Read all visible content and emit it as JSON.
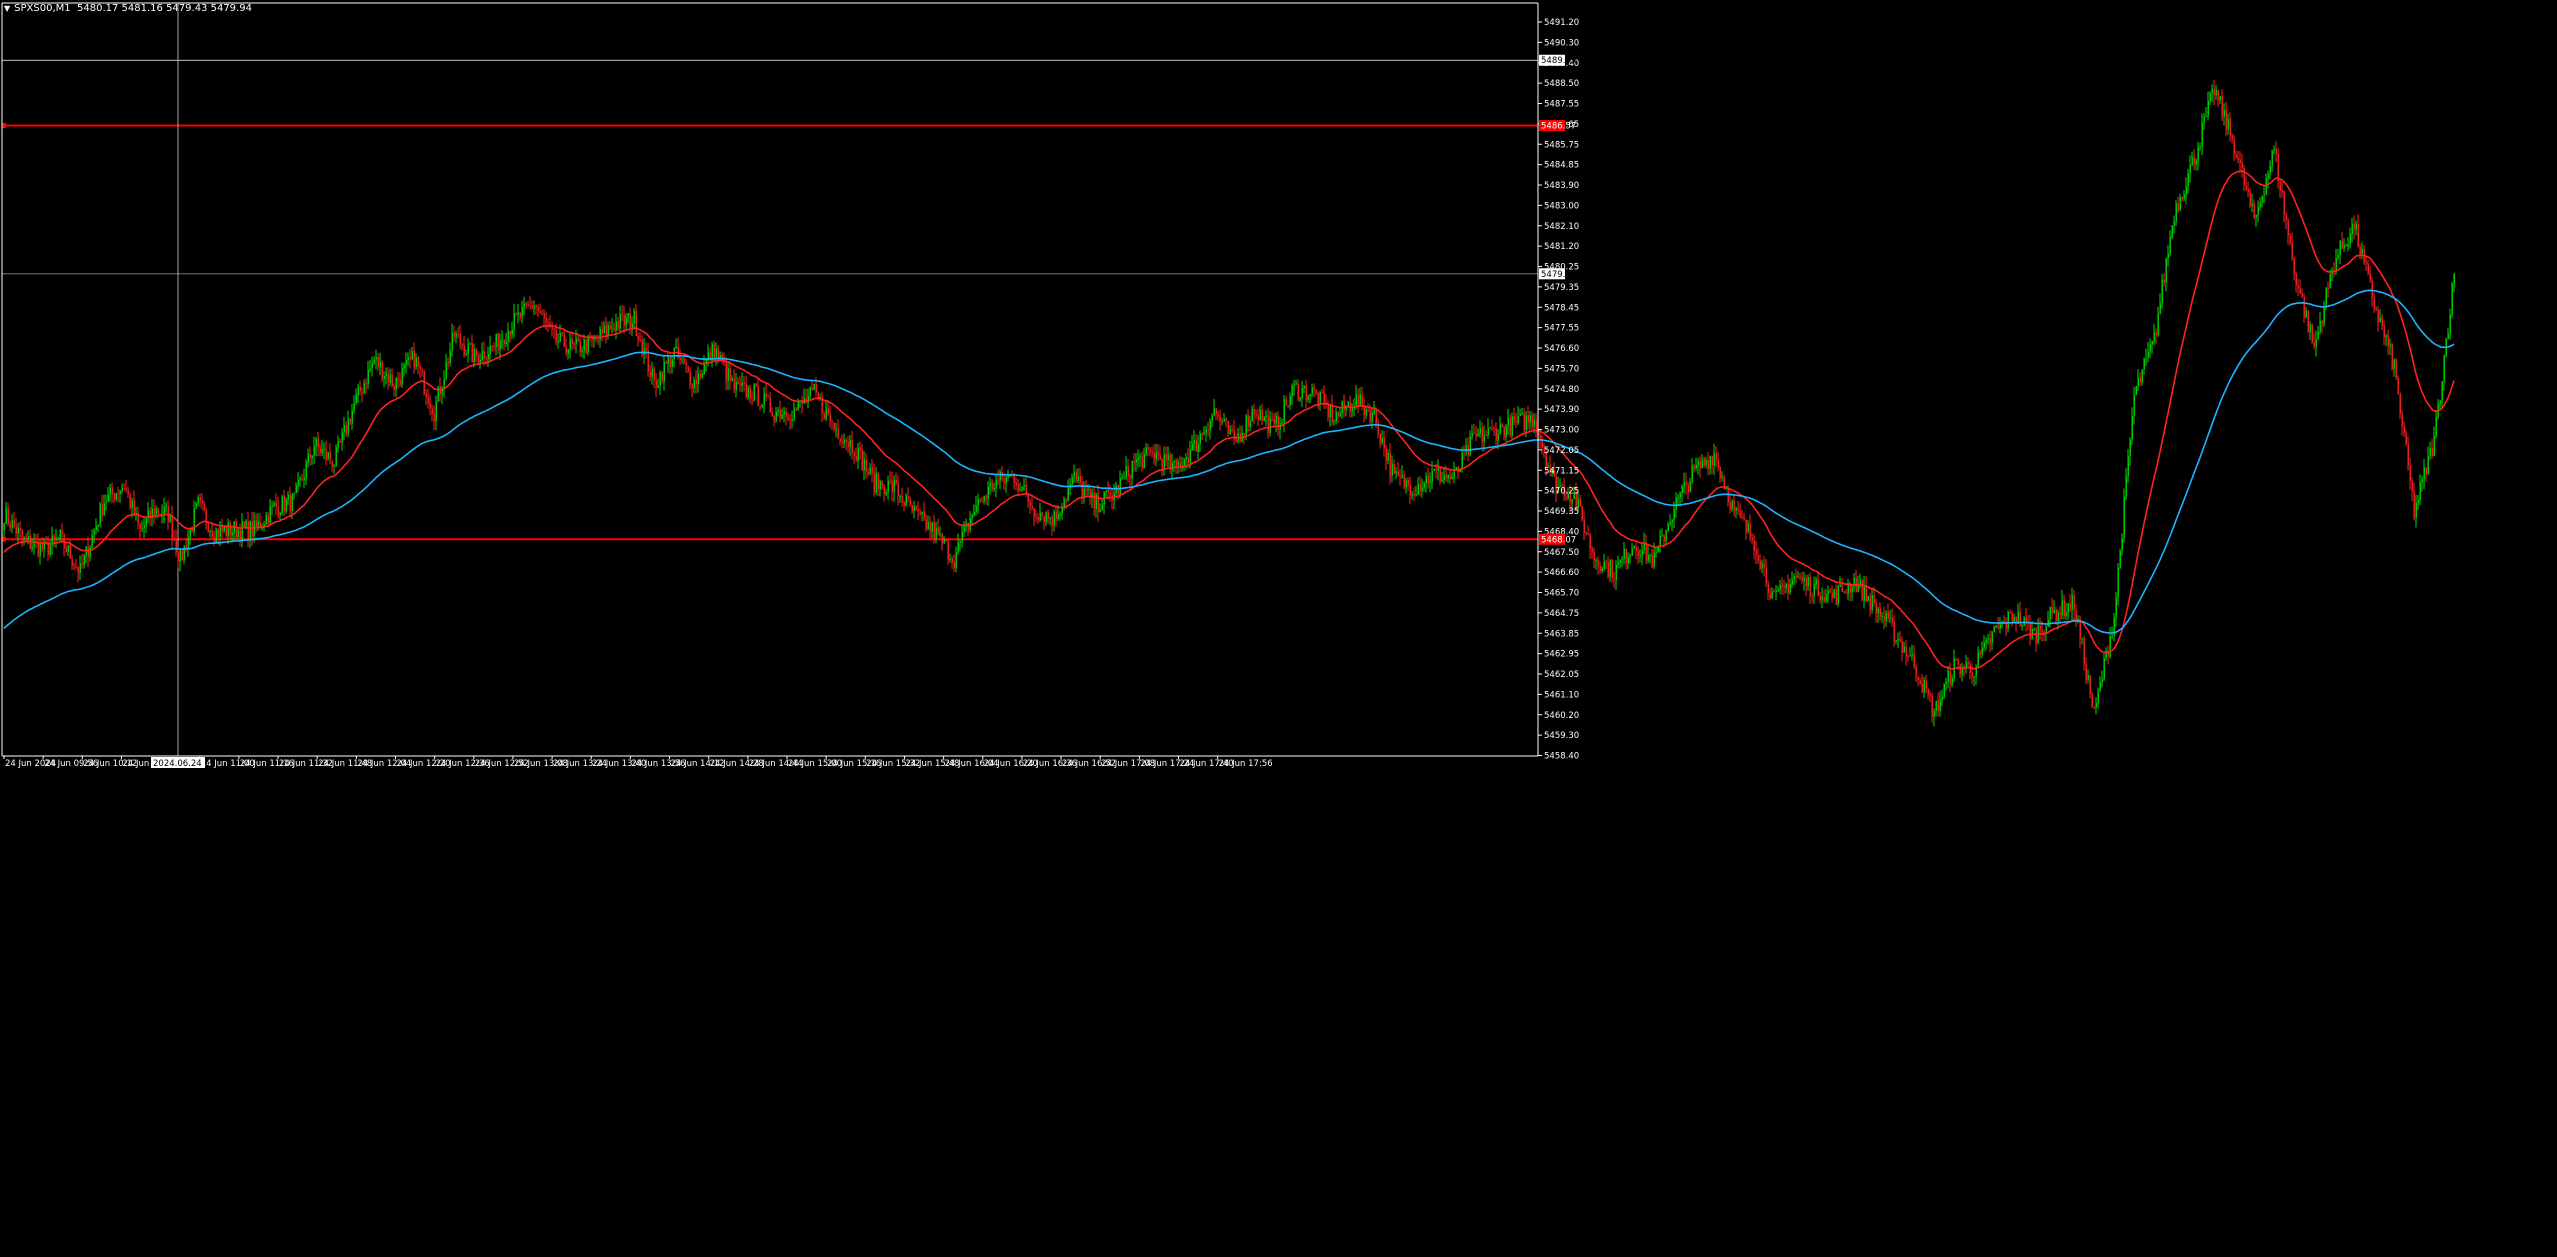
{
  "header": {
    "symbol": "SPXS00,M1",
    "ohlc": "5480.17 5481.16 5479.43 5479.94"
  },
  "colors": {
    "background": "#000000",
    "bull_candle": "#00dd00",
    "bear_candle": "#ff2222",
    "ma_fast": "#ff2222",
    "ma_slow": "#1eb4ff",
    "level_line": "#ff0000",
    "axis": "#ffffff",
    "grid_line": "#ffffff"
  },
  "chart_data": {
    "type": "candlestick",
    "timeframe": "M1",
    "y_ticks": [
      "5491.20",
      "5490.30",
      "5489.40",
      "5488.50",
      "5487.55",
      "5486.65",
      "5485.75",
      "5484.85",
      "5483.90",
      "5483.00",
      "5482.10",
      "5481.20",
      "5480.25",
      "5479.35",
      "5478.45",
      "5477.55",
      "5476.60",
      "5475.70",
      "5474.80",
      "5473.90",
      "5473.00",
      "5472.05",
      "5471.15",
      "5470.25",
      "5469.35",
      "5468.40",
      "5467.50",
      "5466.60",
      "5465.70",
      "5464.75",
      "5463.85",
      "5462.95",
      "5462.05",
      "5461.10",
      "5460.20",
      "5459.30",
      "5458.40"
    ],
    "ylim": [
      5458.0,
      5491.9
    ],
    "x_ticks": [
      "24 Jun 2024",
      "24 Jun 09:56",
      "24 Jun 10:12",
      "24 Jun 10:28",
      "2024.06.24 10:51",
      "24 Jun 11:00",
      "24 Jun 11:16",
      "24 Jun 11:32",
      "24 Jun 11:48",
      "24 Jun 12:04",
      "24 Jun 12:20",
      "24 Jun 12:36",
      "24 Jun 12:52",
      "24 Jun 13:08",
      "24 Jun 13:24",
      "24 Jun 13:40",
      "24 Jun 13:56",
      "24 Jun 14:12",
      "24 Jun 14:28",
      "24 Jun 14:44",
      "24 Jun 15:00",
      "24 Jun 15:16",
      "24 Jun 15:32",
      "24 Jun 15:48",
      "24 Jun 16:04",
      "24 Jun 16:20",
      "24 Jun 16:36",
      "24 Jun 16:52",
      "24 Jun 17:08",
      "24 Jun 17:24",
      "24 Jun 17:40",
      "24 Jun 17:56"
    ],
    "price_labels": [
      {
        "text": "5489.49",
        "value": 5489.49,
        "kind": "line",
        "color": "#ffffff"
      },
      {
        "text": "5486.57",
        "value": 5486.57,
        "kind": "level",
        "color": "#ff0000"
      },
      {
        "text": "5479.94",
        "value": 5479.94,
        "kind": "last",
        "color": "#ffffff"
      },
      {
        "text": "5468.07",
        "value": 5468.07,
        "kind": "level",
        "color": "#ff0000"
      }
    ],
    "crosshair_time": "2024.06.24 10:51",
    "close_anchors": [
      [
        0,
        5469.2
      ],
      [
        10,
        5468.0
      ],
      [
        20,
        5467.6
      ],
      [
        28,
        5468.1
      ],
      [
        38,
        5466.6
      ],
      [
        50,
        5469.8
      ],
      [
        60,
        5470.5
      ],
      [
        68,
        5468.4
      ],
      [
        75,
        5469.4
      ],
      [
        82,
        5469.2
      ],
      [
        88,
        5467.1
      ],
      [
        97,
        5469.6
      ],
      [
        105,
        5468.4
      ],
      [
        115,
        5468.5
      ],
      [
        125,
        5468.5
      ],
      [
        135,
        5469.5
      ],
      [
        145,
        5469.8
      ],
      [
        155,
        5472.3
      ],
      [
        165,
        5471.5
      ],
      [
        175,
        5474.1
      ],
      [
        185,
        5476.1
      ],
      [
        195,
        5475.0
      ],
      [
        205,
        5476.2
      ],
      [
        215,
        5473.8
      ],
      [
        225,
        5477.2
      ],
      [
        235,
        5476.2
      ],
      [
        245,
        5476.7
      ],
      [
        255,
        5477.8
      ],
      [
        265,
        5478.6
      ],
      [
        275,
        5477.0
      ],
      [
        285,
        5476.6
      ],
      [
        295,
        5476.9
      ],
      [
        305,
        5477.7
      ],
      [
        315,
        5477.9
      ],
      [
        325,
        5475.0
      ],
      [
        335,
        5476.4
      ],
      [
        345,
        5475.1
      ],
      [
        355,
        5476.6
      ],
      [
        365,
        5474.8
      ],
      [
        375,
        5474.6
      ],
      [
        385,
        5473.8
      ],
      [
        395,
        5473.8
      ],
      [
        405,
        5474.6
      ],
      [
        415,
        5473.1
      ],
      [
        425,
        5472.2
      ],
      [
        435,
        5470.6
      ],
      [
        445,
        5470.4
      ],
      [
        455,
        5469.2
      ],
      [
        465,
        5468.4
      ],
      [
        475,
        5467.2
      ],
      [
        485,
        5469.4
      ],
      [
        495,
        5470.6
      ],
      [
        505,
        5470.9
      ],
      [
        515,
        5469.4
      ],
      [
        525,
        5469.0
      ],
      [
        535,
        5470.8
      ],
      [
        545,
        5469.6
      ],
      [
        555,
        5470.1
      ],
      [
        565,
        5471.5
      ],
      [
        575,
        5471.9
      ],
      [
        585,
        5471.2
      ],
      [
        595,
        5472.2
      ],
      [
        605,
        5473.8
      ],
      [
        615,
        5472.4
      ],
      [
        625,
        5473.9
      ],
      [
        635,
        5473.0
      ],
      [
        645,
        5474.8
      ],
      [
        655,
        5474.6
      ],
      [
        665,
        5473.5
      ],
      [
        675,
        5474.3
      ],
      [
        685,
        5473.6
      ],
      [
        695,
        5470.8
      ],
      [
        705,
        5470.4
      ],
      [
        715,
        5471.0
      ],
      [
        725,
        5470.8
      ],
      [
        735,
        5472.6
      ],
      [
        745,
        5472.9
      ],
      [
        755,
        5473.2
      ],
      [
        765,
        5473.5
      ],
      [
        775,
        5470.6
      ],
      [
        785,
        5470.0
      ],
      [
        795,
        5467.3
      ],
      [
        805,
        5466.6
      ],
      [
        815,
        5467.9
      ],
      [
        825,
        5467.1
      ],
      [
        835,
        5469.5
      ],
      [
        845,
        5471.1
      ],
      [
        855,
        5471.9
      ],
      [
        865,
        5469.3
      ],
      [
        875,
        5468.0
      ],
      [
        885,
        5465.3
      ],
      [
        895,
        5466.4
      ],
      [
        905,
        5465.9
      ],
      [
        915,
        5465.5
      ],
      [
        925,
        5466.2
      ],
      [
        935,
        5465.1
      ],
      [
        945,
        5463.9
      ],
      [
        955,
        5462.5
      ],
      [
        965,
        5460.3
      ],
      [
        975,
        5462.4
      ],
      [
        985,
        5462.3
      ],
      [
        995,
        5463.9
      ],
      [
        1005,
        5464.7
      ],
      [
        1015,
        5463.8
      ],
      [
        1025,
        5464.8
      ],
      [
        1035,
        5465.2
      ],
      [
        1045,
        5460.2
      ],
      [
        1055,
        5464.6
      ],
      [
        1065,
        5474.5
      ],
      [
        1075,
        5477.0
      ],
      [
        1085,
        5482.7
      ],
      [
        1095,
        5485.1
      ],
      [
        1105,
        5488.2
      ],
      [
        1115,
        5485.7
      ],
      [
        1125,
        5482.3
      ],
      [
        1135,
        5485.5
      ],
      [
        1145,
        5480.1
      ],
      [
        1155,
        5476.6
      ],
      [
        1165,
        5480.5
      ],
      [
        1175,
        5482.1
      ],
      [
        1185,
        5478.6
      ],
      [
        1195,
        5475.8
      ],
      [
        1205,
        5469.3
      ],
      [
        1215,
        5472.5
      ],
      [
        1225,
        5479.9
      ]
    ],
    "series": [
      {
        "name": "",
        "color": "#ff2222",
        "type": "moving_average"
      },
      {
        "name": "",
        "color": "#1eb4ff",
        "type": "moving_average"
      }
    ],
    "grid": false
  }
}
